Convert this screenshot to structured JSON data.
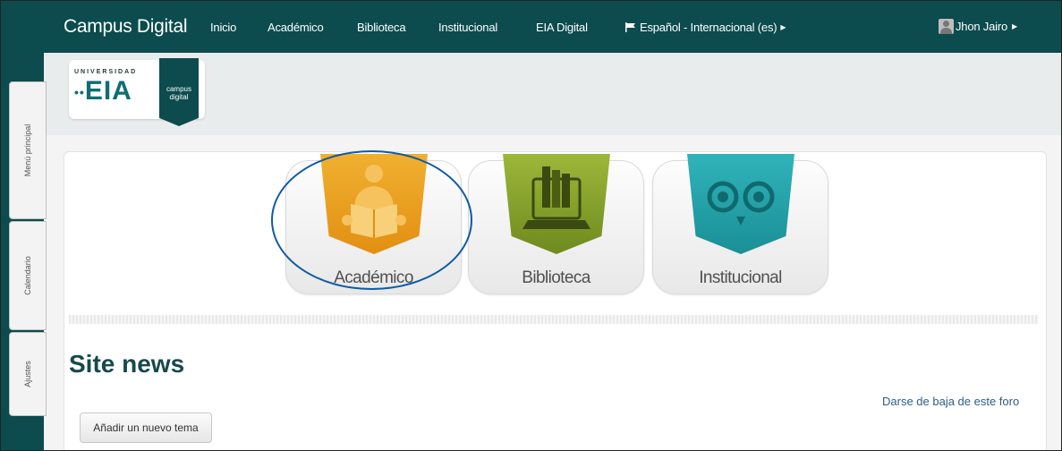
{
  "app": {
    "brand": "Campus Digital"
  },
  "nav": {
    "items": [
      "Inicio",
      "Académico",
      "Biblioteca",
      "Institucional",
      "EIA Digital"
    ],
    "language": "Español - Internacional (es)",
    "user": "Jhon Jairo"
  },
  "logo": {
    "university": "UNIVERSIDAD",
    "name": "EIA",
    "tag_line1": "campus",
    "tag_line2": "digital"
  },
  "side_tabs": [
    "Menú principal",
    "Calendario",
    "Ajustes"
  ],
  "tiles": [
    {
      "label": "Académico",
      "color": "#e8a21d",
      "icon": "reader-icon"
    },
    {
      "label": "Biblioteca",
      "color": "#8ea52a",
      "icon": "library-icon"
    },
    {
      "label": "Institucional",
      "color": "#27a6ad",
      "icon": "owl-icon"
    }
  ],
  "news": {
    "title": "Site news",
    "unsubscribe_link": "Darse de baja de este foro",
    "add_topic_button": "Añadir un nuevo tema"
  },
  "colors": {
    "topbar": "#0c4b4e",
    "highlight_circle": "#0d5aa7"
  }
}
